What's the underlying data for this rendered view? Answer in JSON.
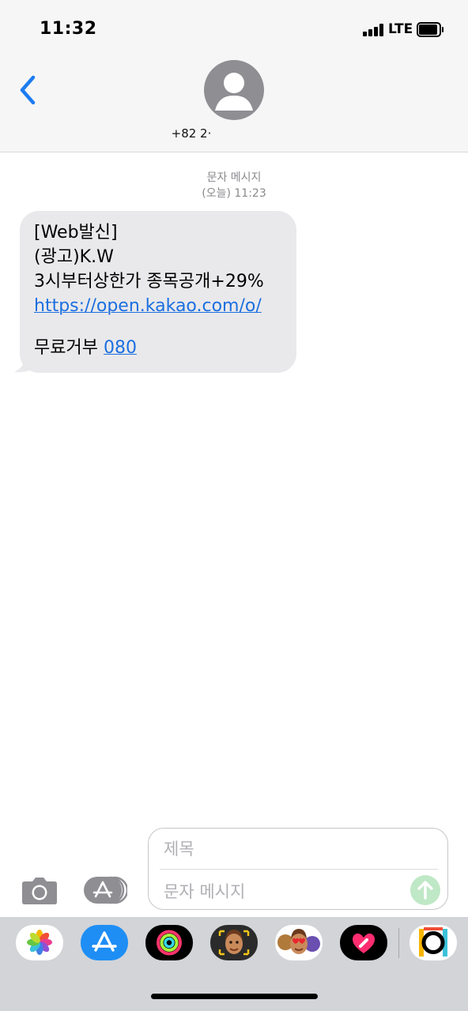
{
  "status_bar": {
    "time": "11:32",
    "network": "LTE"
  },
  "header": {
    "contact": "+82 2·"
  },
  "conversation": {
    "message_type": "문자 메시지",
    "timestamp": "(오늘) 11:23",
    "message": {
      "line1": "[Web발신]",
      "line2": "(광고)K.W",
      "line3": "3시부터상한가 종목공개+29%",
      "link": "https://open.kakao.com/o/",
      "optout_label": "무료거부",
      "optout_number": "080"
    }
  },
  "composer": {
    "subject_placeholder": "제목",
    "message_placeholder": "문자 메시지"
  },
  "app_drawer": {
    "apps": [
      "photos-icon",
      "app-store-icon",
      "activity-icon",
      "memoji-icon",
      "animoji-icon",
      "digital-touch-icon",
      "more-apps-icon"
    ]
  },
  "colors": {
    "link": "#1c6fe0",
    "bubble": "#e9e9eb",
    "send": "#bfe8c6",
    "back": "#1c7cf0"
  }
}
